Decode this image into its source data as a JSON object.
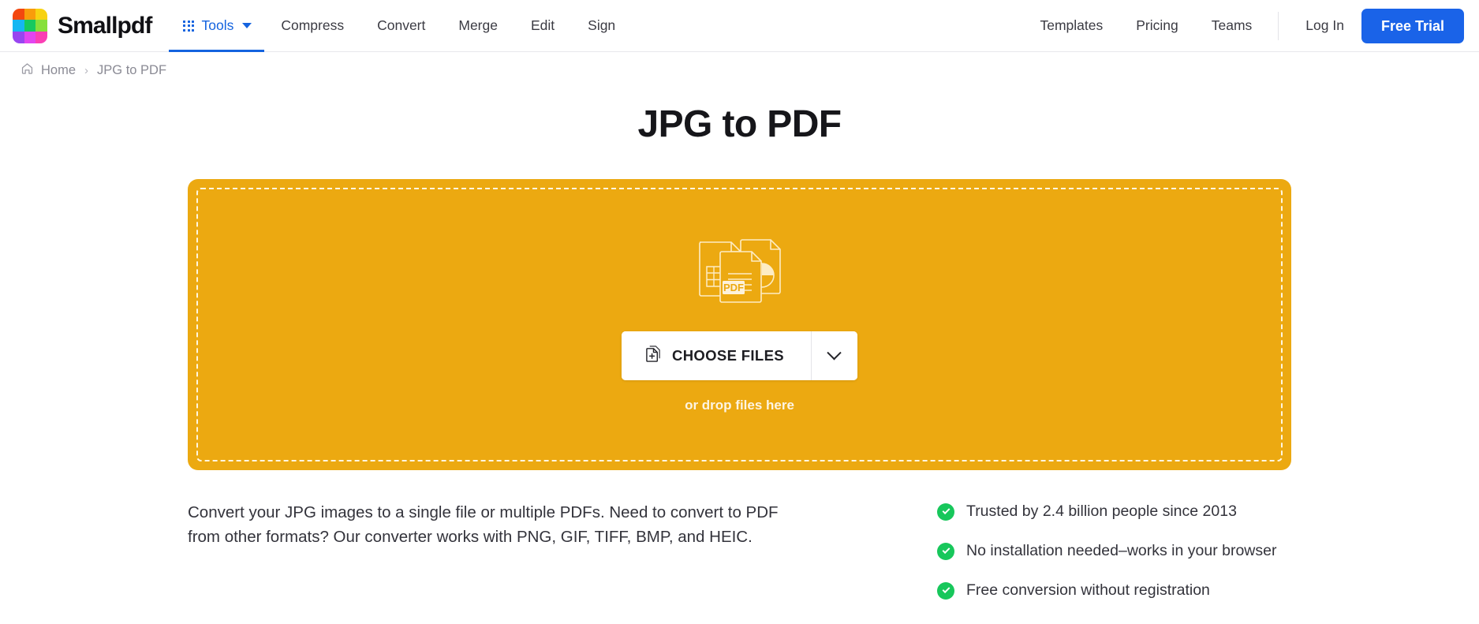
{
  "header": {
    "brand": {
      "name": "Smallpdf",
      "logo_icon": "smallpdf-logo-grid",
      "logo_colors": [
        "#f3470f",
        "#f99c0b",
        "#f7d212",
        "#15b7f2",
        "#16c95f",
        "#86e03b",
        "#9846f0",
        "#e245f0",
        "#fb3fb4"
      ]
    },
    "nav": [
      {
        "label": "Tools",
        "icon": "grid-dots-icon",
        "active": true,
        "color": "#1463df"
      },
      {
        "label": "Compress",
        "active": false
      },
      {
        "label": "Convert",
        "active": false
      },
      {
        "label": "Merge",
        "active": false
      },
      {
        "label": "Edit",
        "active": false
      },
      {
        "label": "Sign",
        "active": false
      }
    ],
    "right_links": [
      {
        "label": "Templates"
      },
      {
        "label": "Pricing"
      },
      {
        "label": "Teams"
      }
    ],
    "login_label": "Log In",
    "trial_label": "Free Trial",
    "trial_color": "#1a63e8"
  },
  "breadcrumb": {
    "home_icon": "home-icon",
    "home_label": "Home",
    "separator": "›",
    "current_label": "JPG to PDF"
  },
  "page": {
    "title": "JPG to PDF"
  },
  "dropzone": {
    "accent_color": "#eca911",
    "illustration_icon": "documents-stack-pdf-icon",
    "pdf_badge": "PDF",
    "choose_label": "CHOOSE FILES",
    "choose_icon": "file-plus-icon",
    "dropdown_icon": "chevron-down-icon",
    "drop_hint": "or drop files here"
  },
  "description": "Convert your JPG images to a single file or multiple PDFs. Need to convert to PDF from other formats? Our converter works with PNG, GIF, TIFF, BMP, and HEIC.",
  "features": {
    "check_color": "#17c75b",
    "items": [
      {
        "label": "Trusted by 2.4 billion people since 2013"
      },
      {
        "label": "No installation needed–works in your browser"
      },
      {
        "label": "Free conversion without registration"
      }
    ]
  }
}
